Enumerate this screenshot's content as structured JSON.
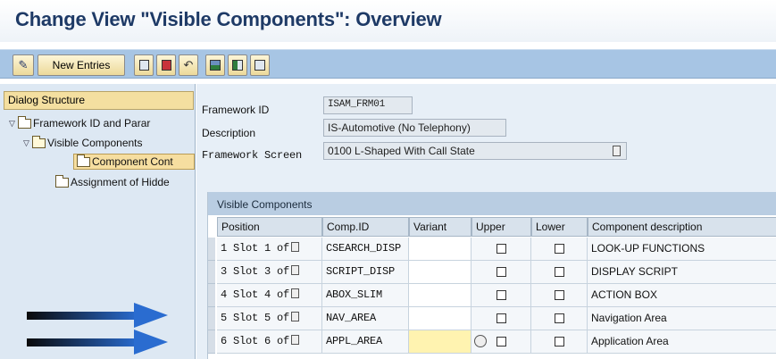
{
  "title": "Change View \"Visible Components\": Overview",
  "toolbar": {
    "new_entries": "New Entries"
  },
  "left": {
    "header": "Dialog Structure",
    "tree": [
      "Framework ID and Parar",
      "Visible Components",
      "Component Cont",
      "Assignment of Hidde"
    ]
  },
  "form": {
    "framework_id_label": "Framework ID",
    "framework_id_value": "ISAM_FRM01",
    "description_label": "Description",
    "description_value": "IS-Automotive (No Telephony)",
    "screen_label": "Framework Screen",
    "screen_code": "0100",
    "screen_value": "L-Shaped With Call State"
  },
  "table": {
    "title": "Visible Components",
    "columns": [
      "Position",
      "Comp.ID",
      "Variant",
      "Upper",
      "Lower",
      "Component description"
    ],
    "rows": [
      {
        "position": "1 Slot 1 of",
        "comp_id": "CSEARCH_DISP",
        "variant": "",
        "description": "LOOK-UP FUNCTIONS"
      },
      {
        "position": "3 Slot 3 of",
        "comp_id": "SCRIPT_DISP",
        "variant": "",
        "description": "DISPLAY SCRIPT"
      },
      {
        "position": "4 Slot 4 of",
        "comp_id": "ABOX_SLIM",
        "variant": "",
        "description": "ACTION BOX"
      },
      {
        "position": "5 Slot 5 of",
        "comp_id": "NAV_AREA",
        "variant": "",
        "description": "Navigation Area"
      },
      {
        "position": "6 Slot 6 of",
        "comp_id": "APPL_AREA",
        "variant": "",
        "description": "Application Area"
      }
    ]
  },
  "colors": {
    "accent": "#a7c5e4",
    "arrow": "#1f5fb8",
    "highlight": "#fff3b0"
  }
}
